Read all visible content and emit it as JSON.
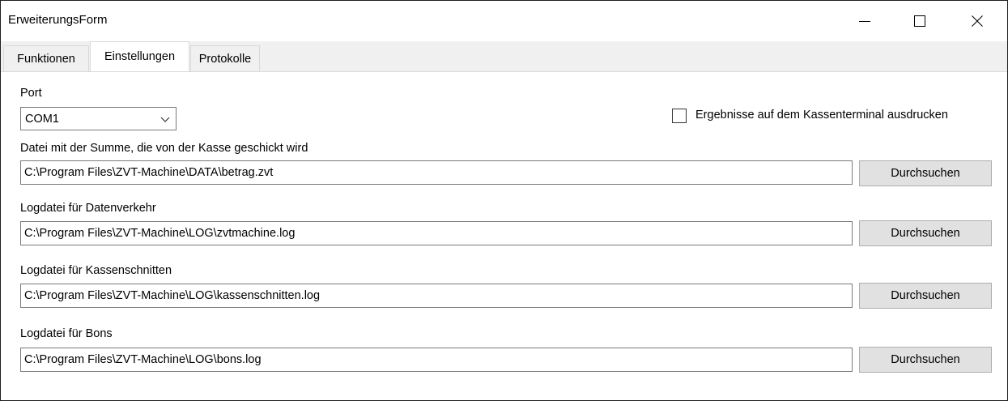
{
  "window": {
    "title": "ErweiterungsForm",
    "minimize_icon": "minimize-icon",
    "maximize_icon": "maximize-icon",
    "close_icon": "close-icon"
  },
  "tabs": [
    {
      "label": "Funktionen",
      "active": false
    },
    {
      "label": "Einstellungen",
      "active": true
    },
    {
      "label": "Protokolle",
      "active": false
    }
  ],
  "settings": {
    "port": {
      "label": "Port",
      "selected": "COM1"
    },
    "print_checkbox": {
      "label": "Ergebnisse auf dem Kassenterminal ausdrucken",
      "checked": false
    },
    "sum_file": {
      "label": "Datei mit der Summe, die von der Kasse geschickt wird",
      "value": "C:\\Program Files\\ZVT-Machine\\DATA\\betrag.zvt",
      "button": "Durchsuchen"
    },
    "traffic_log": {
      "label": "Logdatei für Datenverkehr",
      "value": "C:\\Program Files\\ZVT-Machine\\LOG\\zvtmachine.log",
      "button": "Durchsuchen"
    },
    "cut_log": {
      "label": "Logdatei für Kassenschnitten",
      "value": "C:\\Program Files\\ZVT-Machine\\LOG\\kassenschnitten.log",
      "button": "Durchsuchen"
    },
    "bons_log": {
      "label": "Logdatei für Bons",
      "value": "C:\\Program Files\\ZVT-Machine\\LOG\\bons.log",
      "button": "Durchsuchen"
    }
  }
}
